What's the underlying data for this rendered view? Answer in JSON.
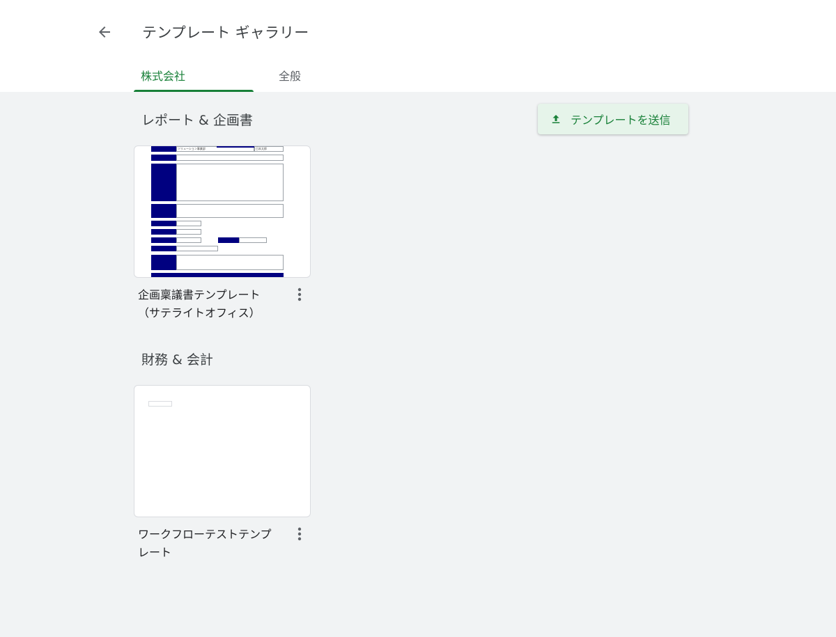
{
  "header": {
    "back_icon": "arrow-back-icon",
    "title": "テンプレート ギャラリー"
  },
  "tabs": [
    {
      "label": "株式会社",
      "active": true
    },
    {
      "label": "全般",
      "active": false
    }
  ],
  "submit_button": {
    "label": "テンプレートを送信",
    "icon": "upload-icon"
  },
  "sections": [
    {
      "title": "レポート & 企画書",
      "cards": [
        {
          "title_line1": "企画稟議書テンプレート",
          "title_line2": "（サテライトオフィス）",
          "more_icon": "more-vert-icon",
          "thumbnail": {
            "department": "ソリューション事業部",
            "name": "日本太郎"
          }
        }
      ]
    },
    {
      "title": "財務 & 会計",
      "cards": [
        {
          "title_line1": "ワークフローテストテンプ",
          "title_line2": "レート",
          "more_icon": "more-vert-icon"
        }
      ]
    }
  ],
  "colors": {
    "accent": "#188038",
    "accent_bg": "#e6f4ea",
    "page_bg": "#f1f3f4",
    "thumbnail_navy": "#000080"
  }
}
